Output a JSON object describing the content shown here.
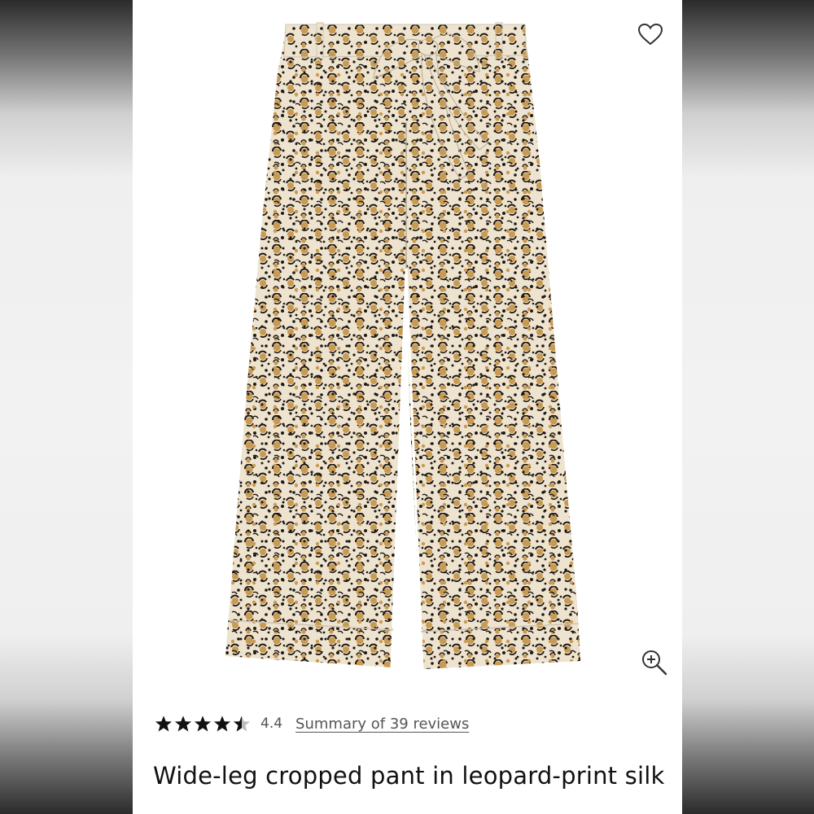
{
  "colors": {
    "background_frame": "#2b2b2b",
    "panel": "#ffffff",
    "star": "#111111",
    "text_muted": "#555555",
    "title": "#111111",
    "print_base": "#eee3cf",
    "print_tan": "#c99a52",
    "print_dark": "#1d1812"
  },
  "product": {
    "image_icon": "leopard-print-pants-image",
    "favorite_icon": "heart-outline-icon",
    "zoom_icon": "zoom-in-icon",
    "rating": {
      "value": "4.4",
      "stars_filled": 4.4,
      "stars_total": 5,
      "reviews_link": "Summary of 39 reviews"
    },
    "title": "Wide-leg cropped pant in leopard-print silk"
  }
}
